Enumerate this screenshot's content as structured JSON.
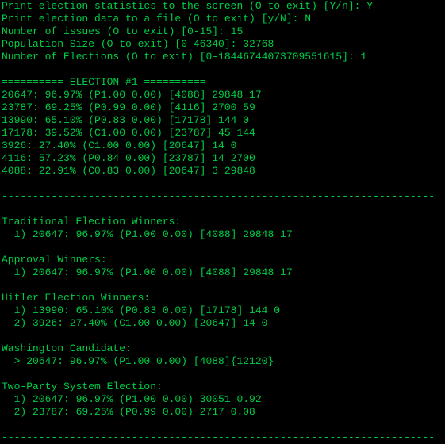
{
  "prompts": {
    "line1": "Print election statistics to the screen (O to exit) [Y/n]: Y",
    "line2": "Print election data to a file (O to exit) [y/N]: N",
    "line3": "Number of issues (O to exit) [0-15]: 15",
    "line4": "Population Size (O to exit) [0-46340]: 32768",
    "line5": "Number of Elections (O to exit) [0-18446744073709551615]: 1"
  },
  "blank1": " ",
  "header": "========== ELECTION #1 ==========",
  "results": [
    "20647: 96.97% (P1.00 0.00) [4088] 29848 17",
    "23787: 69.25% (P0.99 0.00) [4116] 2700 59",
    "13990: 65.10% (P0.83 0.00) [17178] 144 0",
    "17178: 39.52% (C1.00 0.00) [23787] 45 144",
    "3926: 27.40% (C1.00 0.00) [20647] 14 0",
    "4116: 57.23% (P0.84 0.00) [23787] 14 2700",
    "4088: 22.91% (C0.83 0.00) [20647] 3 29848"
  ],
  "blank2": " ",
  "dash1": "----------------------------------------------------------------------",
  "blank3": " ",
  "sections": {
    "traditional": {
      "title": "Traditional Election Winners:",
      "lines": [
        "  1) 20647: 96.97% (P1.00 0.00) [4088] 29848 17"
      ]
    },
    "approval": {
      "title": "Approval Winners:",
      "lines": [
        "  1) 20647: 96.97% (P1.00 0.00) [4088] 29848 17"
      ]
    },
    "hitler": {
      "title": "Hitler Election Winners:",
      "lines": [
        "  1) 13990: 65.10% (P0.83 0.00) [17178] 144 0",
        "  2) 3926: 27.40% (C1.00 0.00) [20647] 14 0"
      ]
    },
    "washington": {
      "title": "Washington Candidate:",
      "lines": [
        "  > 20647: 96.97% (P1.00 0.00) [4088]{12120}"
      ]
    },
    "twoparty": {
      "title": "Two-Party System Election:",
      "lines": [
        "  1) 20647: 96.97% (P1.00 0.00) 30051 0.92",
        "  2) 23787: 69.25% (P0.99 0.00) 2717 0.08"
      ]
    }
  },
  "dash2": "----------------------------------------------------------------------"
}
